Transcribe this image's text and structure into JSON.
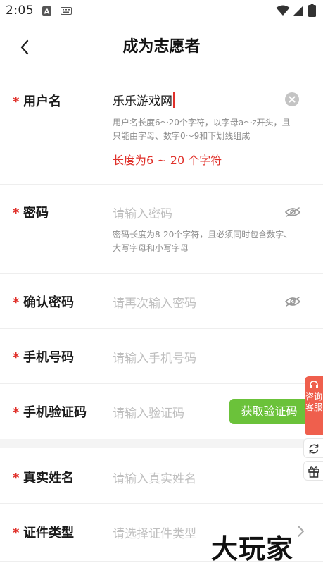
{
  "status_bar": {
    "time": "2:05",
    "icons": [
      "a-badge-icon",
      "keyboard-icon",
      "wifi-icon",
      "signal-icon",
      "battery-icon"
    ]
  },
  "header": {
    "title": "成为志愿者",
    "back_icon": "chevron-left-icon"
  },
  "form": {
    "required_mark": "*",
    "username": {
      "label": "用户名",
      "value": "乐乐游戏网",
      "hint": "用户名长度6～20个字符，以字母a～z开头，且只能由字母、数字0～9和下划线组成",
      "error": "长度为6 ~ 20 个字符",
      "clear_icon": "clear-circle-icon"
    },
    "password": {
      "label": "密码",
      "placeholder": "请输入密码",
      "hint": "密码长度为8-20个字符，且必须同时包含数字、大写字母和小写字母",
      "toggle_icon": "eye-off-icon"
    },
    "confirm_password": {
      "label": "确认密码",
      "placeholder": "请再次输入密码",
      "toggle_icon": "eye-off-icon"
    },
    "phone": {
      "label": "手机号码",
      "placeholder": "请输入手机号码"
    },
    "sms_code": {
      "label": "手机验证码",
      "placeholder": "请输入验证码",
      "button_label": "获取验证码"
    },
    "real_name": {
      "label": "真实姓名",
      "placeholder": "请输入真实姓名"
    },
    "id_type": {
      "label": "证件类型",
      "placeholder": "请选择证件类型",
      "chevron_icon": "chevron-right-icon"
    }
  },
  "side": {
    "service_text": "咨询客服",
    "service_icon": "headset-icon",
    "refresh_icon": "refresh-icon",
    "gift_icon": "gift-icon"
  },
  "watermark": "大玩家",
  "colors": {
    "accent_red": "#e0302a",
    "button_green": "#6bc23a",
    "service_red": "#ef5f4d"
  }
}
